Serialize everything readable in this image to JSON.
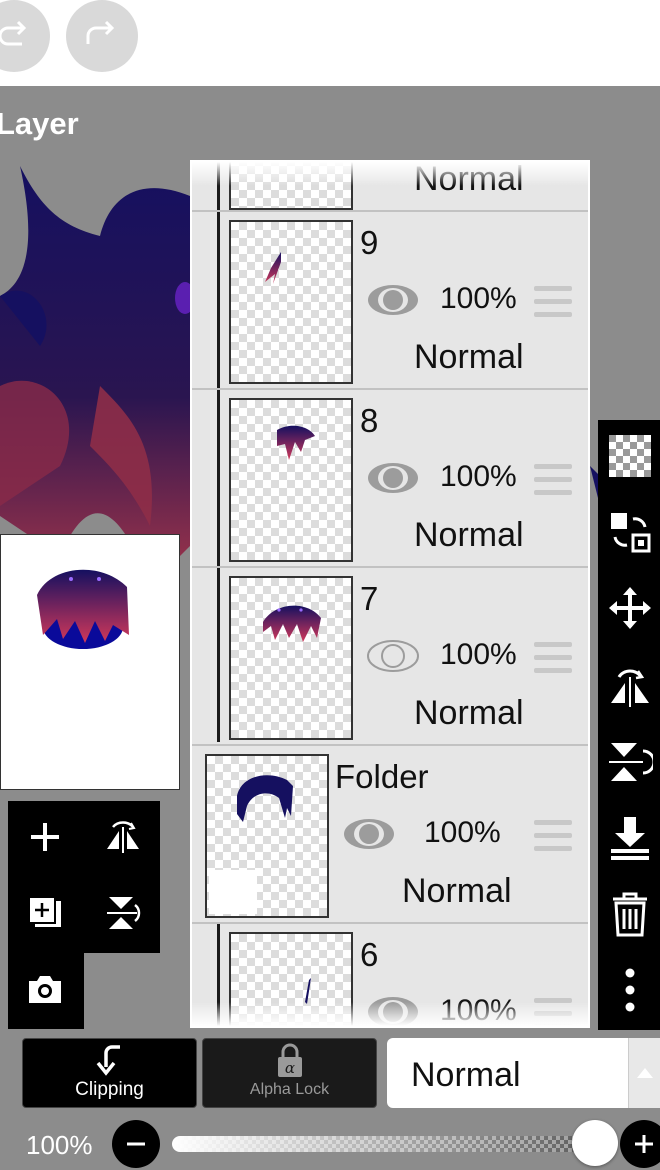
{
  "toolbar": {
    "undo_icon": "undo-icon",
    "redo_icon": "redo-icon"
  },
  "panel_title": "Layer",
  "layers": [
    {
      "name": "",
      "opacity": "",
      "blend": "Normal",
      "visible": true,
      "kind": "layer"
    },
    {
      "name": "9",
      "opacity": "100%",
      "blend": "Normal",
      "visible": true,
      "kind": "layer"
    },
    {
      "name": "8",
      "opacity": "100%",
      "blend": "Normal",
      "visible": true,
      "kind": "layer"
    },
    {
      "name": "7",
      "opacity": "100%",
      "blend": "Normal",
      "visible": false,
      "kind": "layer"
    },
    {
      "name": "Folder",
      "opacity": "100%",
      "blend": "Normal",
      "visible": true,
      "kind": "folder"
    },
    {
      "name": "6",
      "opacity": "100%",
      "blend": "",
      "visible": true,
      "kind": "layer"
    }
  ],
  "left_tools": [
    "add-layer-icon",
    "flip-horizontal-icon",
    "add-from-image-icon",
    "flip-vertical-icon",
    "camera-icon"
  ],
  "right_tools": [
    "transparency-icon",
    "layer-swap-icon",
    "move-icon",
    "flip-horizontal-icon",
    "flip-vertical-icon",
    "merge-down-icon",
    "trash-icon",
    "more-icon"
  ],
  "bottom": {
    "clipping_label": "Clipping",
    "alpha_lock_label": "Alpha Lock",
    "blend_mode": "Normal",
    "opacity_label": "100%",
    "opacity_value": 1.0
  },
  "colors": {
    "panel_bg": "#e6e6e6",
    "bar_bg": "#000000",
    "canvas_bg": "#8c8c8c",
    "hair_dark": "#151060",
    "hair_red": "#c8304a"
  }
}
